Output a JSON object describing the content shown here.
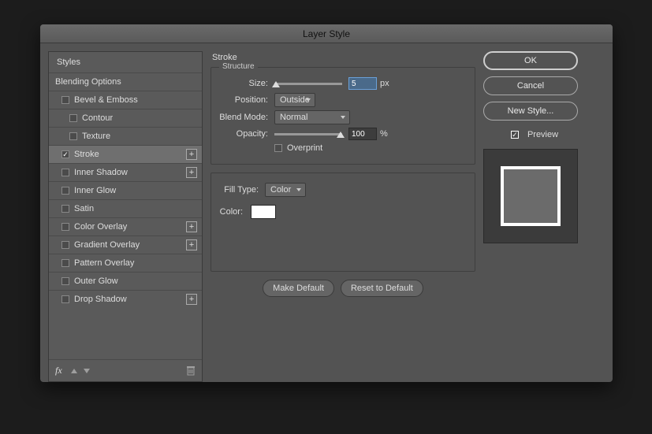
{
  "title": "Layer Style",
  "sidebar": {
    "header": "Styles",
    "blending": "Blending Options",
    "items": [
      {
        "label": "Bevel & Emboss",
        "checked": false,
        "indent": 1,
        "plus": false
      },
      {
        "label": "Contour",
        "checked": false,
        "indent": 2,
        "plus": false
      },
      {
        "label": "Texture",
        "checked": false,
        "indent": 2,
        "plus": false
      },
      {
        "label": "Stroke",
        "checked": true,
        "indent": 1,
        "plus": true,
        "selected": true
      },
      {
        "label": "Inner Shadow",
        "checked": false,
        "indent": 1,
        "plus": true
      },
      {
        "label": "Inner Glow",
        "checked": false,
        "indent": 1,
        "plus": false
      },
      {
        "label": "Satin",
        "checked": false,
        "indent": 1,
        "plus": false
      },
      {
        "label": "Color Overlay",
        "checked": false,
        "indent": 1,
        "plus": true
      },
      {
        "label": "Gradient Overlay",
        "checked": false,
        "indent": 1,
        "plus": true
      },
      {
        "label": "Pattern Overlay",
        "checked": false,
        "indent": 1,
        "plus": false
      },
      {
        "label": "Outer Glow",
        "checked": false,
        "indent": 1,
        "plus": false
      },
      {
        "label": "Drop Shadow",
        "checked": false,
        "indent": 1,
        "plus": true
      }
    ],
    "fx": "fx"
  },
  "main": {
    "section": "Stroke",
    "structure": "Structure",
    "size_label": "Size:",
    "size_value": "5",
    "size_unit": "px",
    "position_label": "Position:",
    "position_value": "Outside",
    "blend_label": "Blend Mode:",
    "blend_value": "Normal",
    "opacity_label": "Opacity:",
    "opacity_value": "100",
    "opacity_unit": "%",
    "overprint": "Overprint",
    "filltype_label": "Fill Type:",
    "filltype_value": "Color",
    "color_label": "Color:",
    "color_value": "#ffffff",
    "make_default": "Make Default",
    "reset_default": "Reset to Default"
  },
  "right": {
    "ok": "OK",
    "cancel": "Cancel",
    "new_style": "New Style...",
    "preview": "Preview"
  }
}
